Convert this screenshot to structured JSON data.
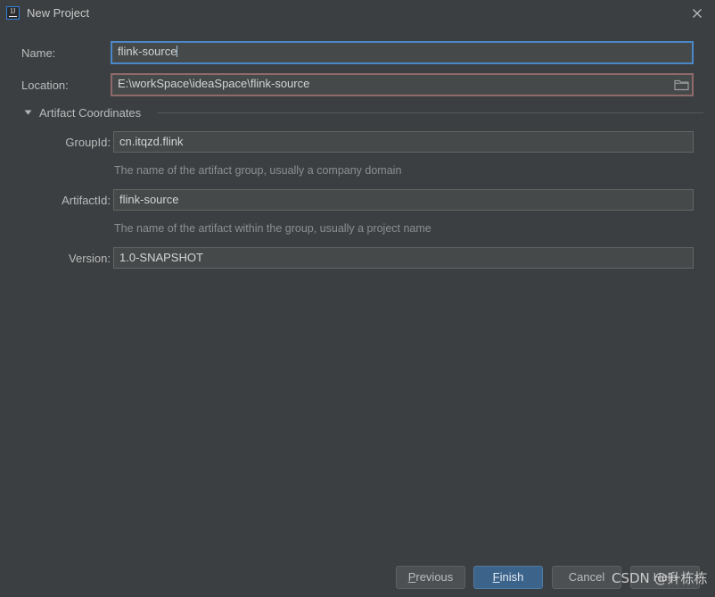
{
  "window": {
    "title": "New Project",
    "app_icon": "intellij-idea-logo",
    "app_icon_letters": "IJ",
    "close_icon": "close-icon",
    "background_color": "#3c3f41"
  },
  "form": {
    "name": {
      "label": "Name:",
      "value": "flink-source",
      "placeholder": "",
      "focused": true,
      "border_color": "#4a88c7"
    },
    "location": {
      "label": "Location:",
      "value": "E:\\workSpace\\ideaSpace\\flink-source",
      "placeholder": "",
      "warning": true,
      "border_color": "#8f6a6a",
      "browse_icon": "folder-icon"
    }
  },
  "artifact_section": {
    "title": "Artifact Coordinates",
    "expanded": true,
    "toggle_icon": "chevron-down-icon",
    "fields": [
      {
        "label": "GroupId:",
        "value": "cn.itqzd.flink",
        "hint": "The name of the artifact group, usually a company domain"
      },
      {
        "label": "ArtifactId:",
        "value": "flink-source",
        "hint": "The name of the artifact within the group, usually a project name"
      },
      {
        "label": "Version:",
        "value": "1.0-SNAPSHOT",
        "hint": ""
      }
    ]
  },
  "buttons": {
    "previous": {
      "label": "Previous",
      "mnemonic": "P",
      "primary": false
    },
    "finish": {
      "label": "Finish",
      "mnemonic": "F",
      "primary": true,
      "color": "#3c6389"
    },
    "cancel": {
      "label": "Cancel",
      "mnemonic": "",
      "primary": false
    },
    "help": {
      "label": "Help",
      "mnemonic": "",
      "primary": false
    }
  },
  "watermark": {
    "text": "CSDN @升栋栋"
  }
}
